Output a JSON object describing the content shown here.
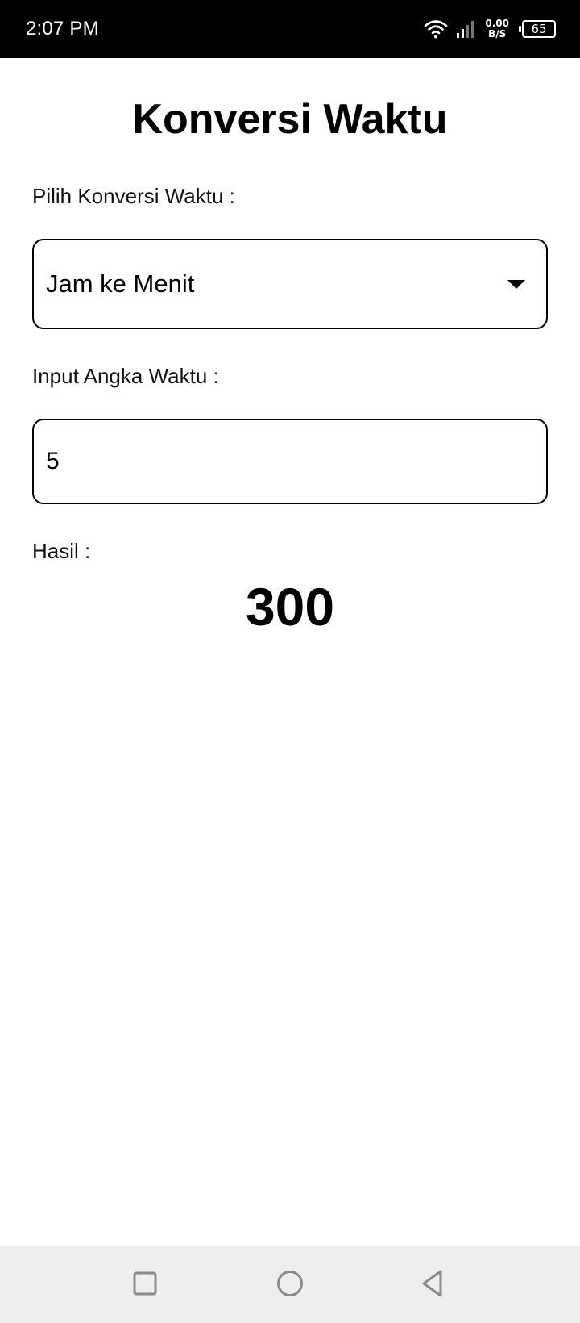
{
  "status_bar": {
    "time": "2:07 PM",
    "net_speed_value": "0.00",
    "net_speed_unit": "B/S",
    "battery": "65"
  },
  "page": {
    "title": "Konversi Waktu"
  },
  "conversion_select": {
    "label": "Pilih Konversi Waktu :",
    "selected": "Jam ke Menit"
  },
  "time_input": {
    "label": "Input Angka Waktu :",
    "value": "5"
  },
  "result": {
    "label": "Hasil :",
    "value": "300"
  },
  "icons": {
    "wifi": "wifi-icon",
    "signal": "signal-icon",
    "battery": "battery-icon",
    "dropdown": "chevron-down-icon",
    "recent": "square-icon",
    "home": "circle-icon",
    "back": "triangle-back-icon"
  }
}
